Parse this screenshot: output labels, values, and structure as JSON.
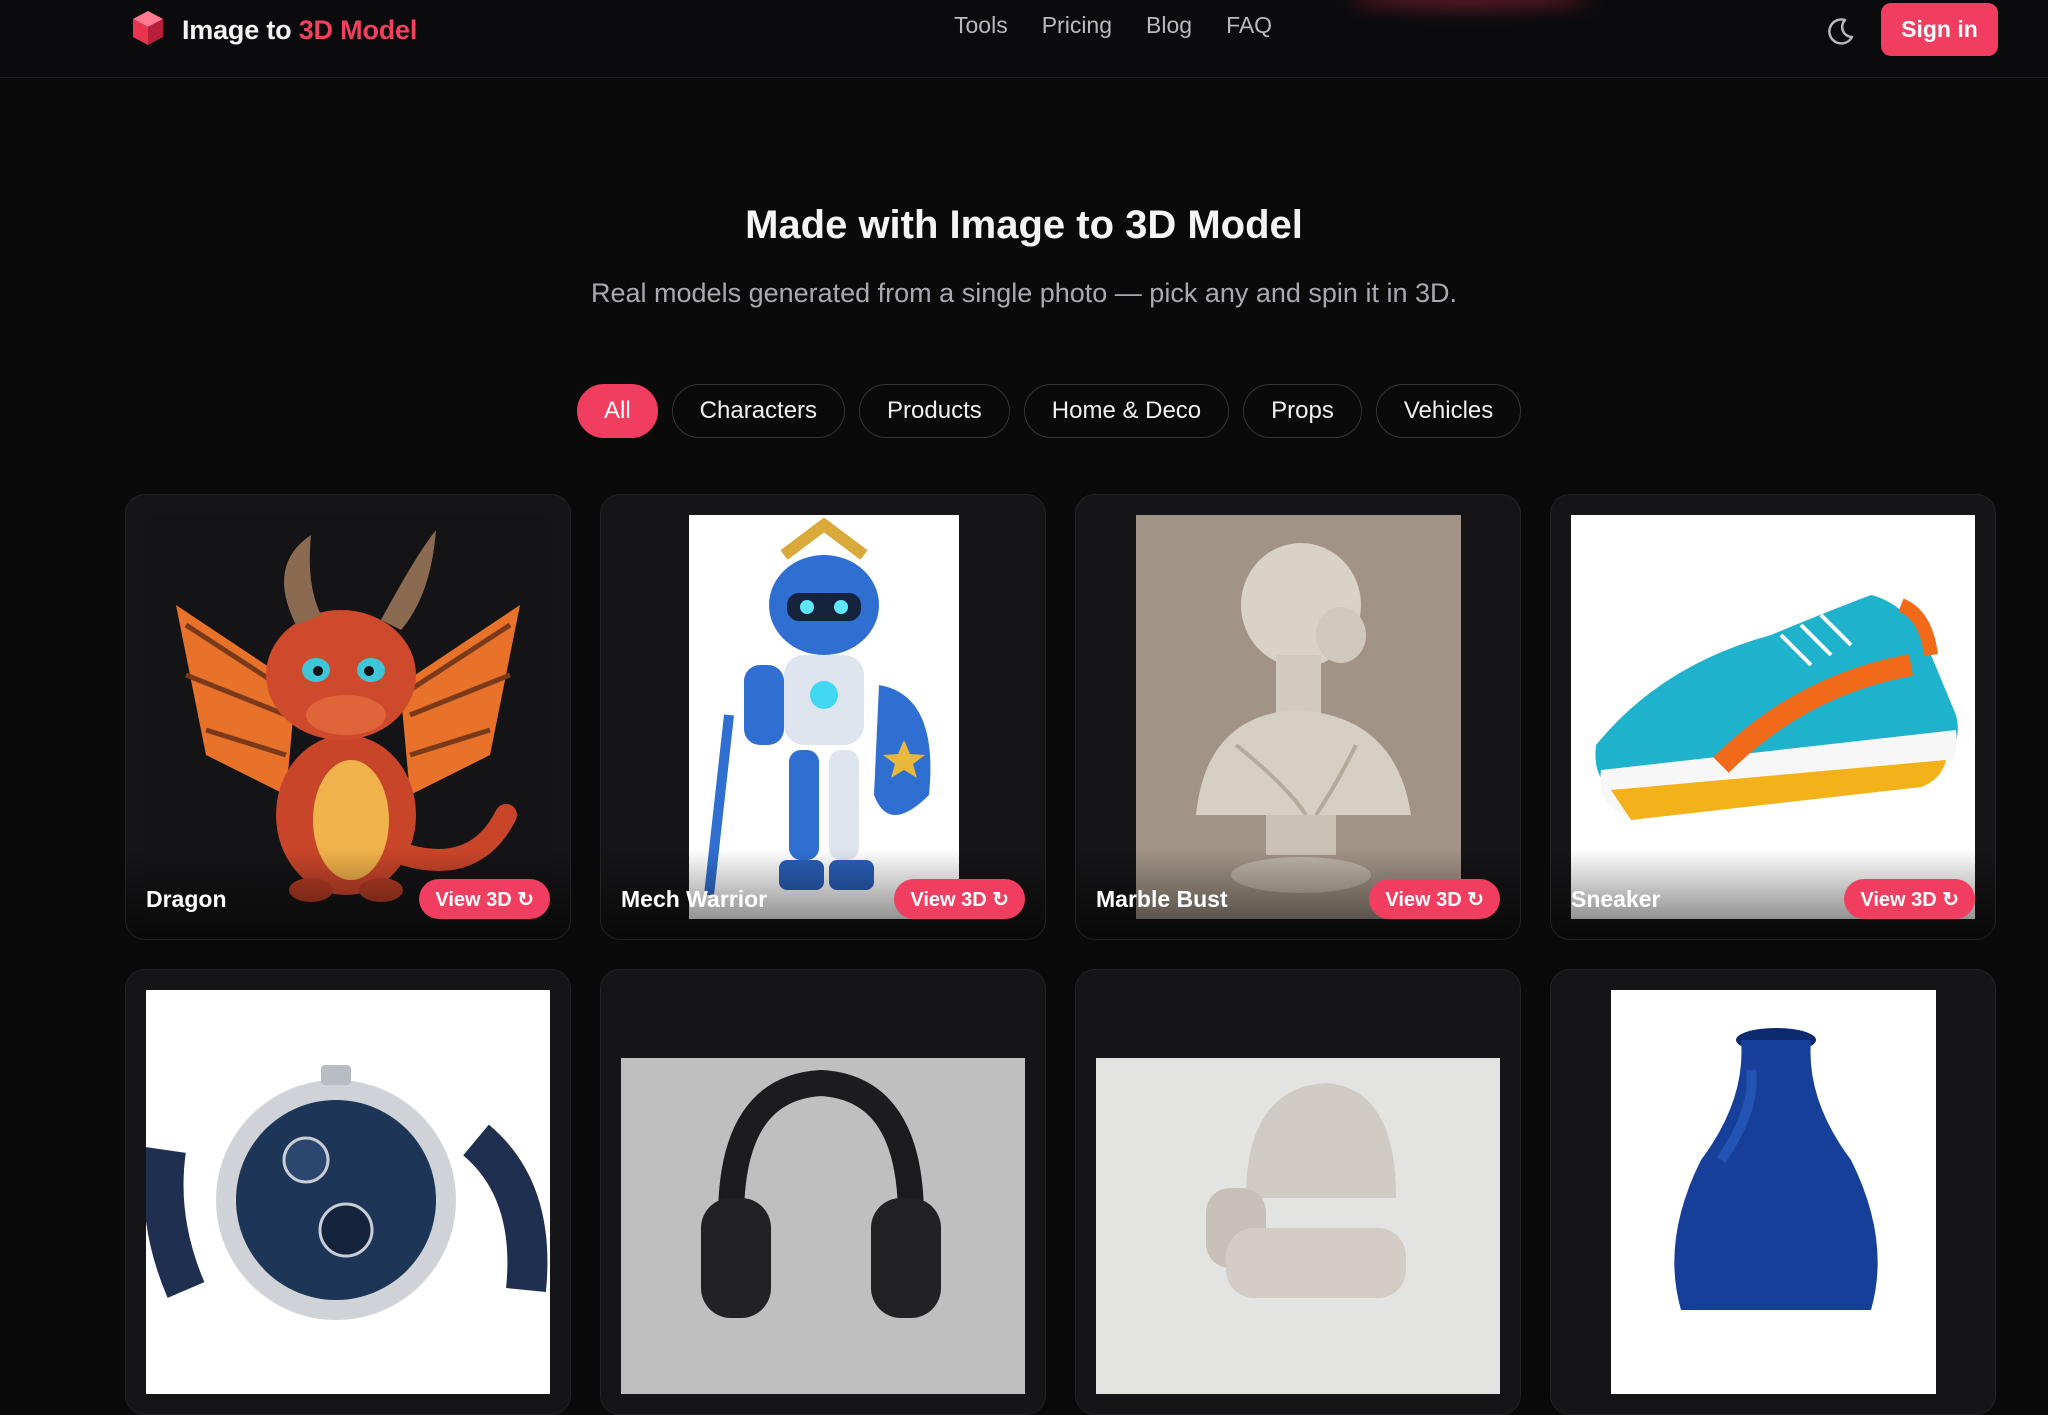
{
  "nav": {
    "brand_prefix": "Image to ",
    "brand_accent": "3D Model",
    "links": [
      "Tools",
      "Pricing",
      "Blog",
      "FAQ"
    ],
    "theme_icon": "moon-icon",
    "signin_label": "Sign in"
  },
  "hero": {
    "title": "Made with Image to 3D Model",
    "subtitle": "Real models generated from a single photo — pick any and spin it in 3D."
  },
  "filters": {
    "items": [
      "All",
      "Characters",
      "Products",
      "Home & Deco",
      "Props",
      "Vehicles"
    ],
    "active": "All"
  },
  "cards": [
    {
      "caption": "Dragon",
      "action": "View 3D ↻"
    },
    {
      "caption": "Mech Warrior",
      "action": "View 3D ↻"
    },
    {
      "caption": "Marble Bust",
      "action": "View 3D ↻"
    },
    {
      "caption": "Sneaker",
      "action": "View 3D ↻"
    },
    {
      "caption": "",
      "action": ""
    },
    {
      "caption": "",
      "action": ""
    },
    {
      "caption": "",
      "action": ""
    },
    {
      "caption": "",
      "action": ""
    }
  ],
  "colors": {
    "accent": "#f13d5f",
    "background": "#0a0a0b",
    "card": "#151517"
  }
}
